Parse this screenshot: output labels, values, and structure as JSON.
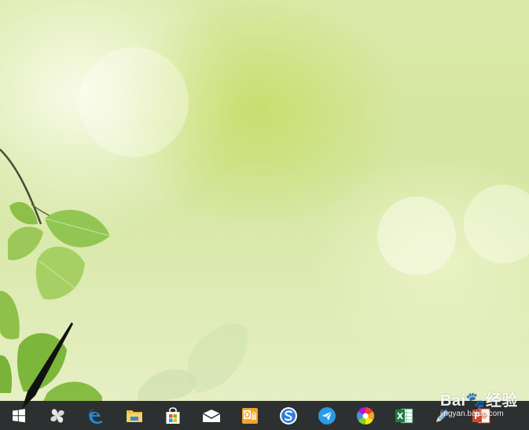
{
  "desktop": {
    "wallpaper": "green leaves bokeh",
    "accent": "#d4e6a0"
  },
  "taskbar": {
    "background": "#2d3030",
    "buttons": [
      {
        "name": "start-button",
        "icon": "windows-logo-icon"
      },
      {
        "name": "task-view-button",
        "icon": "pinwheel-icon"
      },
      {
        "name": "edge-button",
        "icon": "edge-icon"
      },
      {
        "name": "file-explorer-button",
        "icon": "folder-icon"
      },
      {
        "name": "store-button",
        "icon": "store-bag-icon"
      },
      {
        "name": "mail-button",
        "icon": "mail-icon"
      },
      {
        "name": "outlook-button",
        "icon": "outlook-icon"
      },
      {
        "name": "sogou-browser-button",
        "icon": "sogou-s-icon"
      },
      {
        "name": "paper-plane-app-button",
        "icon": "paper-plane-icon"
      },
      {
        "name": "color-wheel-app-button",
        "icon": "color-wheel-icon"
      },
      {
        "name": "excel-button",
        "icon": "excel-icon"
      },
      {
        "name": "pen-app-button",
        "icon": "pen-icon"
      },
      {
        "name": "powerpoint-button",
        "icon": "powerpoint-icon"
      }
    ]
  },
  "watermark": {
    "logo": "Bai🐾经验",
    "url": "jingyan.baidu.com"
  }
}
